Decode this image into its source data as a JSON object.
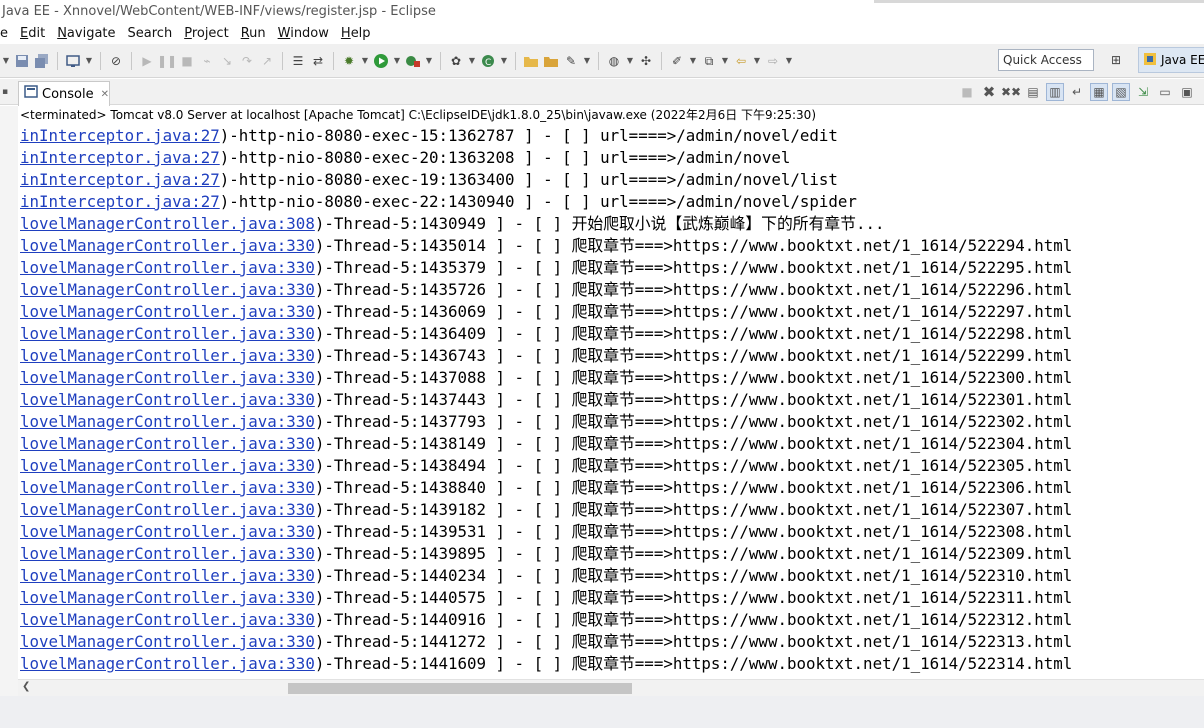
{
  "window": {
    "title": "Java EE - Xnnovel/WebContent/WEB-INF/views/register.jsp - Eclipse"
  },
  "menu": [
    {
      "label": "e",
      "mnemonic": ""
    },
    {
      "label": "Edit",
      "mnemonic": "E",
      "rest": "dit"
    },
    {
      "label": "Navigate",
      "mnemonic": "N",
      "rest": "avigate"
    },
    {
      "label": "Search",
      "mnemonic": "",
      "rest": "Search"
    },
    {
      "label": "Project",
      "mnemonic": "P",
      "rest": "roject"
    },
    {
      "label": "Run",
      "mnemonic": "R",
      "rest": "un"
    },
    {
      "label": "Window",
      "mnemonic": "W",
      "rest": "indow"
    },
    {
      "label": "Help",
      "mnemonic": "H",
      "rest": "elp"
    }
  ],
  "toolbar": {
    "quick_access_placeholder": "Quick Access",
    "perspective_label": "Java EE"
  },
  "console": {
    "tab_label": "Console",
    "process_line": "<terminated> Tomcat v8.0 Server at localhost [Apache Tomcat] C:\\EclipseIDE\\jdk1.8.0_25\\bin\\javaw.exe (2022年2月6日 下午9:25:30)",
    "lines": [
      {
        "link": "inInterceptor.java:27",
        "text": ")-http-nio-8080-exec-15:1362787 ] - [  ]  url====>/admin/novel/edit"
      },
      {
        "link": "inInterceptor.java:27",
        "text": ")-http-nio-8080-exec-20:1363208 ] - [  ]  url====>/admin/novel"
      },
      {
        "link": "inInterceptor.java:27",
        "text": ")-http-nio-8080-exec-19:1363400 ] - [  ]  url====>/admin/novel/list"
      },
      {
        "link": "inInterceptor.java:27",
        "text": ")-http-nio-8080-exec-22:1430940 ] - [  ]  url====>/admin/novel/spider"
      },
      {
        "link": "lovelManagerController.java:308",
        "text": ")-Thread-5:1430949 ] - [  ]  开始爬取小说【武炼巅峰】下的所有章节..."
      },
      {
        "link": "lovelManagerController.java:330",
        "text": ")-Thread-5:1435014 ] - [  ]  爬取章节===>https://www.booktxt.net/1_1614/522294.html"
      },
      {
        "link": "lovelManagerController.java:330",
        "text": ")-Thread-5:1435379 ] - [  ]  爬取章节===>https://www.booktxt.net/1_1614/522295.html"
      },
      {
        "link": "lovelManagerController.java:330",
        "text": ")-Thread-5:1435726 ] - [  ]  爬取章节===>https://www.booktxt.net/1_1614/522296.html"
      },
      {
        "link": "lovelManagerController.java:330",
        "text": ")-Thread-5:1436069 ] - [  ]  爬取章节===>https://www.booktxt.net/1_1614/522297.html"
      },
      {
        "link": "lovelManagerController.java:330",
        "text": ")-Thread-5:1436409 ] - [  ]  爬取章节===>https://www.booktxt.net/1_1614/522298.html"
      },
      {
        "link": "lovelManagerController.java:330",
        "text": ")-Thread-5:1436743 ] - [  ]  爬取章节===>https://www.booktxt.net/1_1614/522299.html"
      },
      {
        "link": "lovelManagerController.java:330",
        "text": ")-Thread-5:1437088 ] - [  ]  爬取章节===>https://www.booktxt.net/1_1614/522300.html"
      },
      {
        "link": "lovelManagerController.java:330",
        "text": ")-Thread-5:1437443 ] - [  ]  爬取章节===>https://www.booktxt.net/1_1614/522301.html"
      },
      {
        "link": "lovelManagerController.java:330",
        "text": ")-Thread-5:1437793 ] - [  ]  爬取章节===>https://www.booktxt.net/1_1614/522302.html"
      },
      {
        "link": "lovelManagerController.java:330",
        "text": ")-Thread-5:1438149 ] - [  ]  爬取章节===>https://www.booktxt.net/1_1614/522304.html"
      },
      {
        "link": "lovelManagerController.java:330",
        "text": ")-Thread-5:1438494 ] - [  ]  爬取章节===>https://www.booktxt.net/1_1614/522305.html"
      },
      {
        "link": "lovelManagerController.java:330",
        "text": ")-Thread-5:1438840 ] - [  ]  爬取章节===>https://www.booktxt.net/1_1614/522306.html"
      },
      {
        "link": "lovelManagerController.java:330",
        "text": ")-Thread-5:1439182 ] - [  ]  爬取章节===>https://www.booktxt.net/1_1614/522307.html"
      },
      {
        "link": "lovelManagerController.java:330",
        "text": ")-Thread-5:1439531 ] - [  ]  爬取章节===>https://www.booktxt.net/1_1614/522308.html"
      },
      {
        "link": "lovelManagerController.java:330",
        "text": ")-Thread-5:1439895 ] - [  ]  爬取章节===>https://www.booktxt.net/1_1614/522309.html"
      },
      {
        "link": "lovelManagerController.java:330",
        "text": ")-Thread-5:1440234 ] - [  ]  爬取章节===>https://www.booktxt.net/1_1614/522310.html"
      },
      {
        "link": "lovelManagerController.java:330",
        "text": ")-Thread-5:1440575 ] - [  ]  爬取章节===>https://www.booktxt.net/1_1614/522311.html"
      },
      {
        "link": "lovelManagerController.java:330",
        "text": ")-Thread-5:1440916 ] - [  ]  爬取章节===>https://www.booktxt.net/1_1614/522312.html"
      },
      {
        "link": "lovelManagerController.java:330",
        "text": ")-Thread-5:1441272 ] - [  ]  爬取章节===>https://www.booktxt.net/1_1614/522313.html"
      },
      {
        "link": "lovelManagerController.java:330",
        "text": ")-Thread-5:1441609 ] - [  ]  爬取章节===>https://www.booktxt.net/1_1614/522314.html"
      }
    ]
  },
  "colors": {
    "link": "#1f3fbf",
    "toolbar_bg": "#f0f0f0",
    "console_bg": "#ffffff"
  }
}
